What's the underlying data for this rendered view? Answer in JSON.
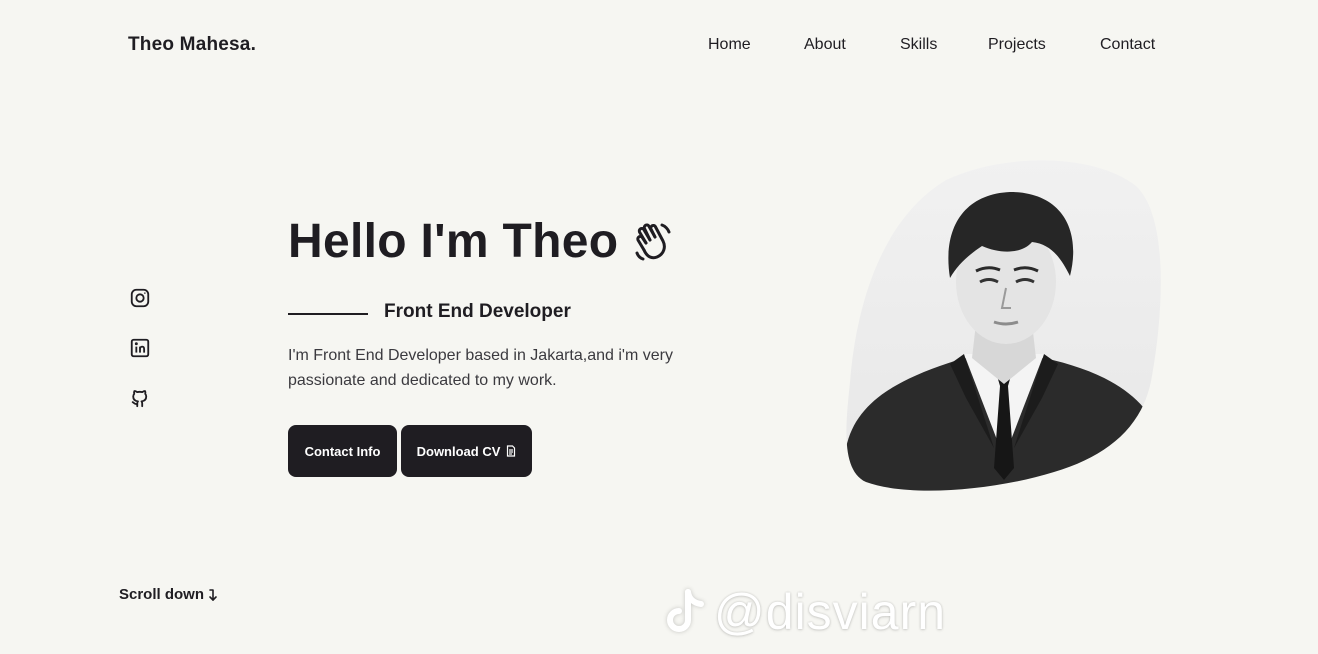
{
  "header": {
    "logo": "Theo Mahesa.",
    "nav": [
      "Home",
      "About",
      "Skills",
      "Projects",
      "Contact"
    ]
  },
  "socials": [
    {
      "name": "instagram",
      "icon": "instagram-icon"
    },
    {
      "name": "linkedin",
      "icon": "linkedin-icon"
    },
    {
      "name": "github",
      "icon": "github-icon"
    }
  ],
  "hero": {
    "title": "Hello I'm Theo",
    "title_icon": "waving-hand-icon",
    "subtitle": "Front End Developer",
    "description": "I'm Front End Developer based in Jakarta,and i'm very passionate and dedicated to my work.",
    "buttons": {
      "contact": "Contact Info",
      "download": "Download CV",
      "download_icon": "document-icon"
    }
  },
  "portrait": {
    "alt": "portrait-photo",
    "style": "grayscale"
  },
  "scroll": {
    "label": "Scroll down",
    "icon": "arrow-down-curved-icon"
  },
  "watermark": {
    "text": "@disviarn",
    "icon": "tiktok-icon"
  },
  "colors": {
    "background": "#f6f6f2",
    "text": "#1f1d22",
    "button": "#1f1d22",
    "button_text": "#ffffff"
  }
}
